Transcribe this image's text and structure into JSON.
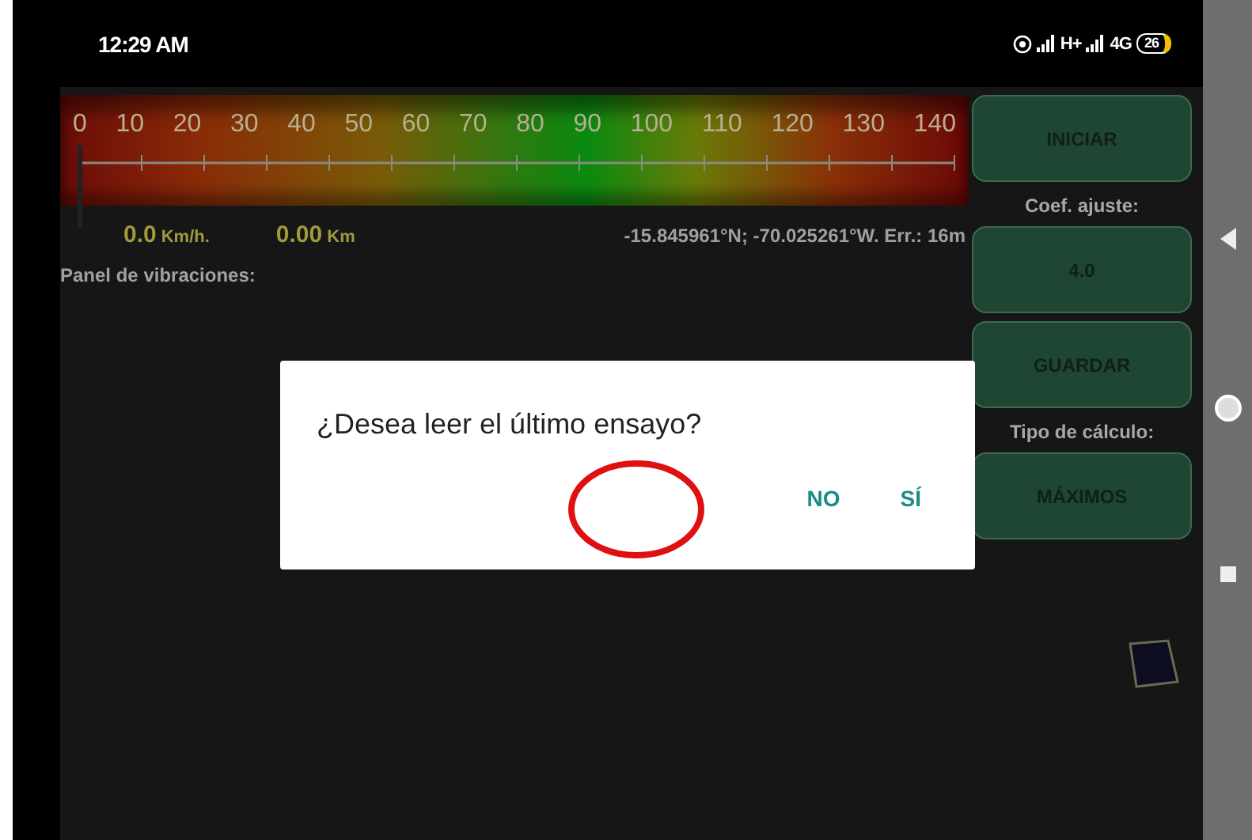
{
  "status_bar": {
    "time": "12:29 AM",
    "network_1": "H+",
    "network_2": "4G",
    "battery": "26"
  },
  "gauge": {
    "ticks": [
      "0",
      "10",
      "20",
      "30",
      "40",
      "50",
      "60",
      "70",
      "80",
      "90",
      "100",
      "110",
      "120",
      "130",
      "140"
    ],
    "level": 0
  },
  "readouts": {
    "speed": "0.0",
    "speed_unit": "Km/h.",
    "distance": "0.00",
    "distance_unit": "Km",
    "position": "-15.845961°N; -70.025261°W. Err.: 16m"
  },
  "panel_title": "Panel de vibraciones:",
  "controls": [
    {
      "kind": "button",
      "label": "INICIAR"
    },
    {
      "kind": "caption",
      "label": "Coef. ajuste:"
    },
    {
      "kind": "button",
      "label": "4.0"
    },
    {
      "kind": "button",
      "label": "GUARDAR"
    },
    {
      "kind": "caption",
      "label": "Tipo de cálculo:"
    },
    {
      "kind": "button",
      "label": "MÁXIMOS"
    }
  ],
  "dialog": {
    "message": "¿Desea leer el último ensayo?",
    "buttons": [
      "NO",
      "SÍ"
    ]
  }
}
